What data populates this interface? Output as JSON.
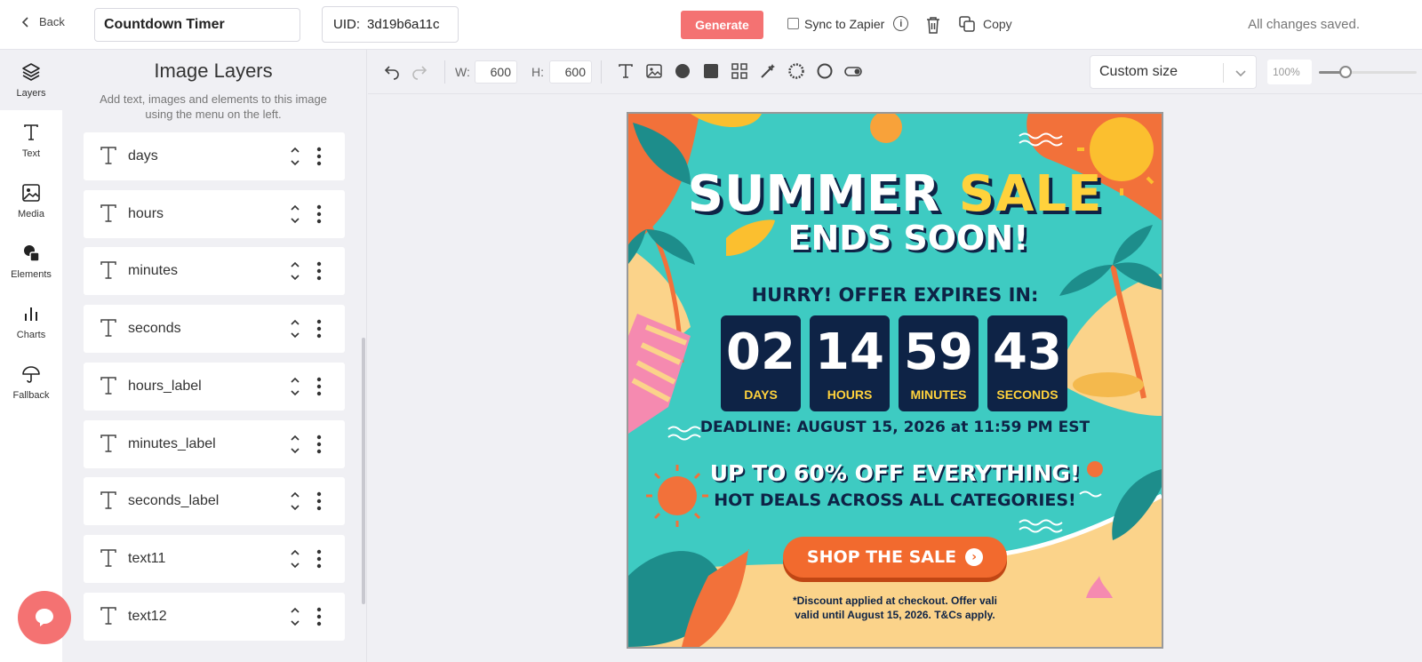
{
  "topbar": {
    "back_label": "Back",
    "template_name": "Countdown Timer",
    "uid_label": "UID:",
    "uid_value": "3d19b6a11c",
    "generate_label": "Generate",
    "sync_label": "Sync to Zapier",
    "copy_label": "Copy",
    "status": "All changes saved.",
    "accent_color": "#f47272"
  },
  "rail": {
    "items": [
      {
        "label": "Layers",
        "icon": "layers-icon"
      },
      {
        "label": "Text",
        "icon": "text-icon"
      },
      {
        "label": "Media",
        "icon": "image-icon"
      },
      {
        "label": "Elements",
        "icon": "shapes-icon"
      },
      {
        "label": "Charts",
        "icon": "bar-chart-icon"
      },
      {
        "label": "Fallback",
        "icon": "umbrella-icon"
      }
    ]
  },
  "layers_panel": {
    "title": "Image Layers",
    "subtitle": "Add text, images and elements to this image using the menu on the left.",
    "layers": [
      {
        "name": "days"
      },
      {
        "name": "hours"
      },
      {
        "name": "minutes"
      },
      {
        "name": "seconds"
      },
      {
        "name": "hours_label"
      },
      {
        "name": "minutes_label"
      },
      {
        "name": "seconds_label"
      },
      {
        "name": "text11"
      },
      {
        "name": "text12"
      }
    ]
  },
  "toolbar": {
    "width_label": "W:",
    "width_value": "600",
    "height_label": "H:",
    "height_value": "600",
    "size_preset": "Custom size",
    "zoom": "100%",
    "zoom_level": 0.27
  },
  "canvas": {
    "headline_1": "SUMMER",
    "headline_1_highlight": "SALE",
    "headline_2": "ENDS SOON!",
    "hurry": "HURRY! OFFER EXPIRES IN:",
    "countdown": [
      {
        "value": "02",
        "label": "DAYS"
      },
      {
        "value": "14",
        "label": "HOURS"
      },
      {
        "value": "59",
        "label": "MINUTES"
      },
      {
        "value": "43",
        "label": "SECONDS"
      }
    ],
    "deadline": "DEADLINE: AUGUST 15, 2026 at 11:59 PM EST",
    "offer_1": "UP TO 60% OFF EVERYTHING!",
    "offer_2": "HOT DEALS ACROSS ALL CATEGORIES!",
    "cta": "SHOP THE SALE",
    "disclaimer_1": "*Discount applied at checkout. Offer vali",
    "disclaimer_2": "valid until August 15, 2026. T&Cs apply."
  }
}
